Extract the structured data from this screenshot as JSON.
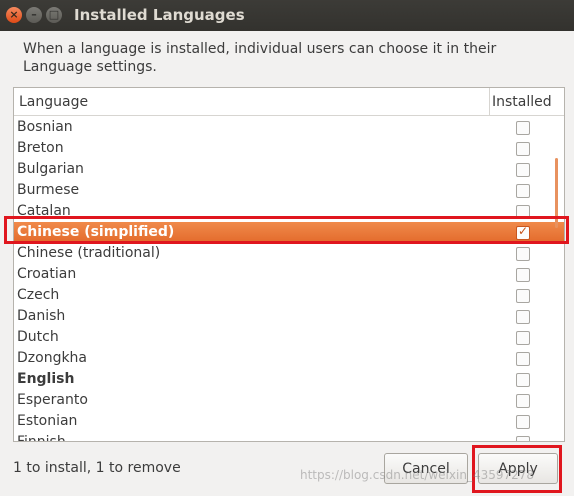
{
  "window": {
    "title": "Installed Languages",
    "close_glyph": "×",
    "minimize_glyph": "–",
    "maximize_glyph": "□"
  },
  "description": "When a language is installed, individual users can choose it in their Language settings.",
  "table": {
    "headers": {
      "language": "Language",
      "installed": "Installed"
    },
    "rows": [
      {
        "label": "Bosnian",
        "installed": false
      },
      {
        "label": "Breton",
        "installed": false
      },
      {
        "label": "Bulgarian",
        "installed": false
      },
      {
        "label": "Burmese",
        "installed": false
      },
      {
        "label": "Catalan",
        "installed": false
      },
      {
        "label": "Chinese (simplified)",
        "installed": true,
        "selected": true
      },
      {
        "label": "Chinese (traditional)",
        "installed": false
      },
      {
        "label": "Croatian",
        "installed": false
      },
      {
        "label": "Czech",
        "installed": false
      },
      {
        "label": "Danish",
        "installed": false
      },
      {
        "label": "Dutch",
        "installed": false
      },
      {
        "label": "Dzongkha",
        "installed": false
      },
      {
        "label": "English",
        "installed": false,
        "bold": true
      },
      {
        "label": "Esperanto",
        "installed": false
      },
      {
        "label": "Estonian",
        "installed": false
      },
      {
        "label": "Finnish",
        "installed": false
      }
    ]
  },
  "status": "1 to install, 1 to remove",
  "buttons": {
    "cancel": "Cancel",
    "apply": "Apply"
  },
  "watermark": "https://blog.csdn.net/weixin_43597278",
  "colors": {
    "selection": "#e8743a",
    "highlight_box": "#e0161e"
  }
}
